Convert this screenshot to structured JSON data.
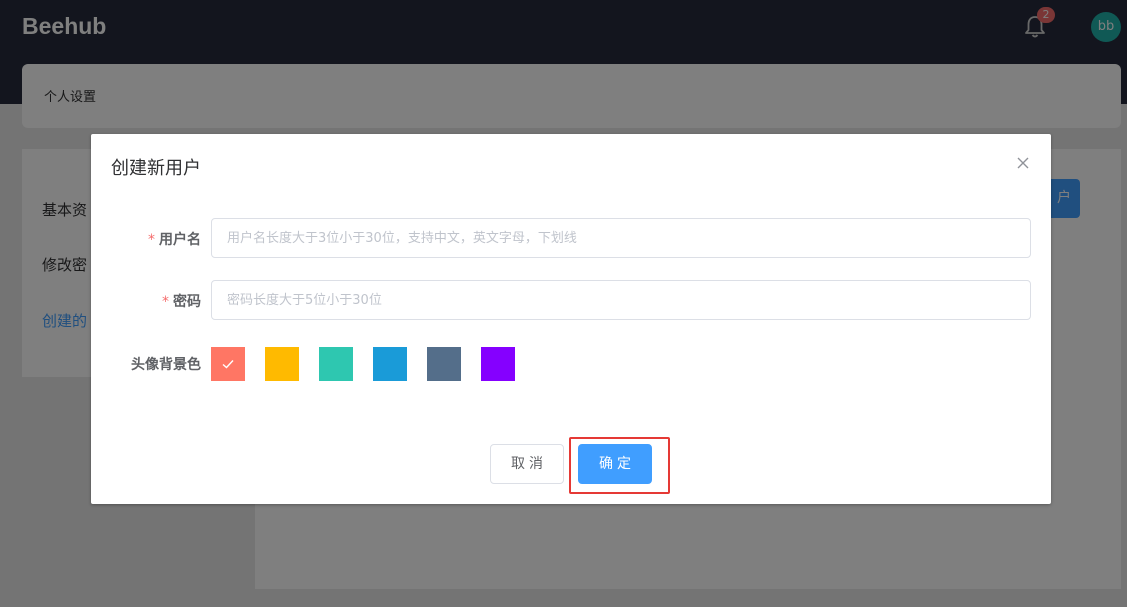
{
  "header": {
    "logo": "Beehub",
    "notification_count": "2",
    "avatar_initials": "bb"
  },
  "breadcrumb": {
    "title": "个人设置"
  },
  "sidebar": {
    "items": [
      {
        "label": "基本资"
      },
      {
        "label": "修改密"
      },
      {
        "label": "创建的"
      }
    ]
  },
  "main": {
    "button_label": "户"
  },
  "dialog": {
    "title": "创建新用户",
    "username": {
      "required_mark": "*",
      "label": "用户名",
      "placeholder": "用户名长度大于3位小于30位，支持中文，英文字母，下划线"
    },
    "password": {
      "required_mark": "*",
      "label": "密码",
      "placeholder": "密码长度大于5位小于30位"
    },
    "avatar_bg": {
      "label": "头像背景色",
      "colors": [
        "#ff7664",
        "#ffba00",
        "#2ec7b0",
        "#1a9bd8",
        "#546e8a",
        "#8500ff"
      ],
      "selected_index": 0
    },
    "cancel_label": "取消",
    "confirm_label": "确定"
  },
  "colors": {
    "header_bg": "#262b3c",
    "primary": "#409eff",
    "danger": "#f56c6c",
    "highlight_box": "#e53935"
  }
}
